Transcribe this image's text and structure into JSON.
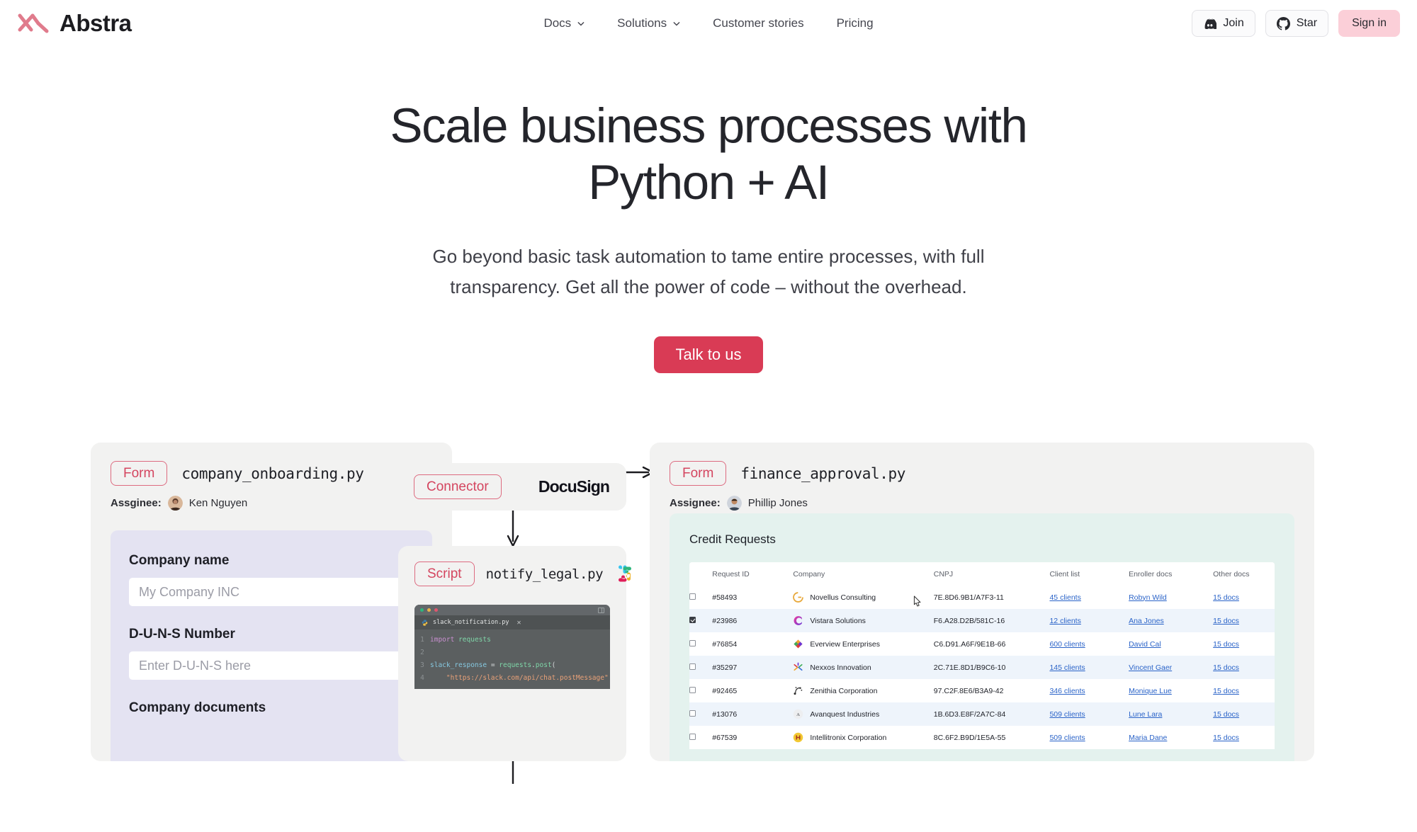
{
  "nav": {
    "brand": "Abstra",
    "links": [
      {
        "label": "Docs",
        "has_chevron": true
      },
      {
        "label": "Solutions",
        "has_chevron": true
      },
      {
        "label": "Customer stories",
        "has_chevron": false
      },
      {
        "label": "Pricing",
        "has_chevron": false
      }
    ],
    "join_label": "Join",
    "star_label": "Star",
    "signin_label": "Sign in"
  },
  "hero": {
    "title_line1": "Scale business processes with",
    "title_line2": "Python + AI",
    "subtitle": "Go beyond basic task automation to tame entire processes, with full transparency. Get all the power of code – without the overhead.",
    "cta_label": "Talk to us",
    "cta_color": "#d93b55"
  },
  "diagram": {
    "card_form_onboarding": {
      "tag": "Form",
      "filename": "company_onboarding.py",
      "assignee_label": "Assginee:",
      "assignee_name": "Ken Nguyen",
      "fields": [
        {
          "label": "Company name",
          "placeholder": "My Company INC"
        },
        {
          "label": "D-U-N-S Number",
          "placeholder": "Enter D-U-N-S here"
        },
        {
          "label": "Company documents",
          "placeholder": ""
        }
      ]
    },
    "card_connector": {
      "tag": "Connector",
      "integration": "DocuSign"
    },
    "card_script": {
      "tag": "Script",
      "filename": "notify_legal.py",
      "integration_icon": "slack-icon",
      "editor": {
        "tab_name": "slack_notification.py",
        "lines": [
          {
            "n": "1",
            "text": "import requests"
          },
          {
            "n": "2",
            "text": ""
          },
          {
            "n": "3",
            "text": "slack_response = requests.post("
          },
          {
            "n": "4",
            "text": "    \"https://slack.com/api/chat.postMessage\""
          }
        ]
      }
    },
    "card_form_finance": {
      "tag": "Form",
      "filename": "finance_approval.py",
      "assignee_label": "Assignee:",
      "assignee_name": "Phillip Jones",
      "table": {
        "title": "Credit Requests",
        "columns": [
          "",
          "Request ID",
          "Company",
          "CNPJ",
          "Client list",
          "Enroller docs",
          "Other docs"
        ],
        "rows": [
          {
            "checked": false,
            "id": "#58493",
            "company": "Novellus Consulting",
            "cnpj": "7E.8D6.9B1/A7F3-11",
            "clients": "45 clients",
            "enroller": "Robyn Wild",
            "docs": "15 docs"
          },
          {
            "checked": true,
            "id": "#23986",
            "company": "Vistara Solutions",
            "cnpj": "F6.A28.D2B/581C-16",
            "clients": "12 clients",
            "enroller": "Ana Jones",
            "docs": "15 docs"
          },
          {
            "checked": false,
            "id": "#76854",
            "company": "Everview Enterprises",
            "cnpj": "C6.D91.A6F/9E1B-66",
            "clients": "600 clients",
            "enroller": "David Cal",
            "docs": "15 docs"
          },
          {
            "checked": false,
            "id": "#35297",
            "company": "Nexxos Innovation",
            "cnpj": "2C.71E.8D1/B9C6-10",
            "clients": "145 clients",
            "enroller": "Vincent Gaer",
            "docs": "15 docs"
          },
          {
            "checked": false,
            "id": "#92465",
            "company": "Zenithia Corporation",
            "cnpj": "97.C2F.8E6/B3A9-42",
            "clients": "346 clients",
            "enroller": "Monique Lue",
            "docs": "15 docs"
          },
          {
            "checked": false,
            "id": "#13076",
            "company": "Avanquest Industries",
            "cnpj": "1B.6D3.E8F/2A7C-84",
            "clients": "509 clients",
            "enroller": "Lune Lara",
            "docs": "15 docs"
          },
          {
            "checked": false,
            "id": "#67539",
            "company": "Intellitronix Corporation",
            "cnpj": "8C.6F2.B9D/1E5A-55",
            "clients": "509 clients",
            "enroller": "Maria Dane",
            "docs": "15 docs"
          }
        ]
      }
    }
  },
  "colors": {
    "brand_pink": "#e07b8c",
    "tag_red": "#d4455f",
    "form_panel": "#e4e3f2",
    "table_panel": "#e4f2ee",
    "card_bg": "#f2f2f1",
    "link_blue": "#2a63c8"
  }
}
